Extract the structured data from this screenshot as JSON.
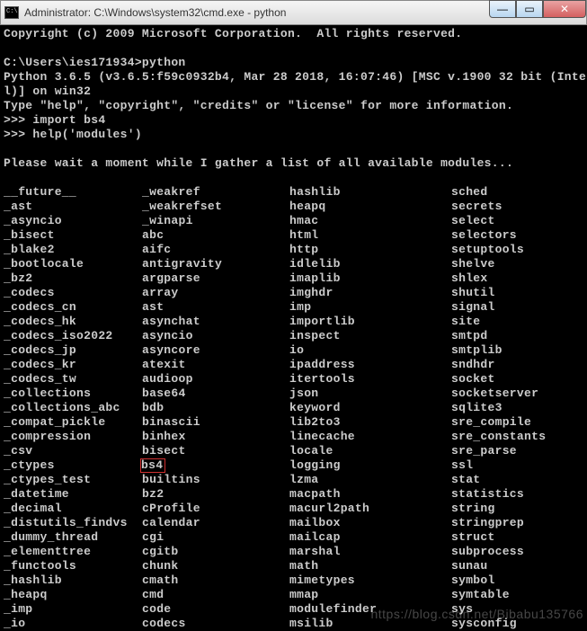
{
  "titlebar": {
    "title": "Administrator: C:\\Windows\\system32\\cmd.exe - python",
    "min_symbol": "—",
    "max_symbol": "▭",
    "close_symbol": "✕"
  },
  "header_lines": [
    "Copyright (c) 2009 Microsoft Corporation.  All rights reserved.",
    "",
    "C:\\Users\\ies171934>python",
    "Python 3.6.5 (v3.6.5:f59c0932b4, Mar 28 2018, 16:07:46) [MSC v.1900 32 bit (Inte",
    "l)] on win32",
    "Type \"help\", \"copyright\", \"credits\" or \"license\" for more information.",
    ">>> import bs4",
    ">>> help('modules')",
    "",
    "Please wait a moment while I gather a list of all available modules...",
    ""
  ],
  "modules": [
    [
      "__future__",
      "_weakref",
      "hashlib",
      "sched"
    ],
    [
      "_ast",
      "_weakrefset",
      "heapq",
      "secrets"
    ],
    [
      "_asyncio",
      "_winapi",
      "hmac",
      "select"
    ],
    [
      "_bisect",
      "abc",
      "html",
      "selectors"
    ],
    [
      "_blake2",
      "aifc",
      "http",
      "setuptools"
    ],
    [
      "_bootlocale",
      "antigravity",
      "idlelib",
      "shelve"
    ],
    [
      "_bz2",
      "argparse",
      "imaplib",
      "shlex"
    ],
    [
      "_codecs",
      "array",
      "imghdr",
      "shutil"
    ],
    [
      "_codecs_cn",
      "ast",
      "imp",
      "signal"
    ],
    [
      "_codecs_hk",
      "asynchat",
      "importlib",
      "site"
    ],
    [
      "_codecs_iso2022",
      "asyncio",
      "inspect",
      "smtpd"
    ],
    [
      "_codecs_jp",
      "asyncore",
      "io",
      "smtplib"
    ],
    [
      "_codecs_kr",
      "atexit",
      "ipaddress",
      "sndhdr"
    ],
    [
      "_codecs_tw",
      "audioop",
      "itertools",
      "socket"
    ],
    [
      "_collections",
      "base64",
      "json",
      "socketserver"
    ],
    [
      "_collections_abc",
      "bdb",
      "keyword",
      "sqlite3"
    ],
    [
      "_compat_pickle",
      "binascii",
      "lib2to3",
      "sre_compile"
    ],
    [
      "_compression",
      "binhex",
      "linecache",
      "sre_constants"
    ],
    [
      "_csv",
      "bisect",
      "locale",
      "sre_parse"
    ],
    [
      "_ctypes",
      "bs4",
      "logging",
      "ssl"
    ],
    [
      "_ctypes_test",
      "builtins",
      "lzma",
      "stat"
    ],
    [
      "_datetime",
      "bz2",
      "macpath",
      "statistics"
    ],
    [
      "_decimal",
      "cProfile",
      "macurl2path",
      "string"
    ],
    [
      "_distutils_findvs",
      "calendar",
      "mailbox",
      "stringprep"
    ],
    [
      "_dummy_thread",
      "cgi",
      "mailcap",
      "struct"
    ],
    [
      "_elementtree",
      "cgitb",
      "marshal",
      "subprocess"
    ],
    [
      "_functools",
      "chunk",
      "math",
      "sunau"
    ],
    [
      "_hashlib",
      "cmath",
      "mimetypes",
      "symbol"
    ],
    [
      "_heapq",
      "cmd",
      "mmap",
      "symtable"
    ],
    [
      "_imp",
      "code",
      "modulefinder",
      "sys"
    ],
    [
      "_io",
      "codecs",
      "msilib",
      "sysconfig"
    ]
  ],
  "highlight": {
    "row": 19,
    "col": 1
  },
  "watermark": "https://blog.csdn.net/Bibabu135766"
}
